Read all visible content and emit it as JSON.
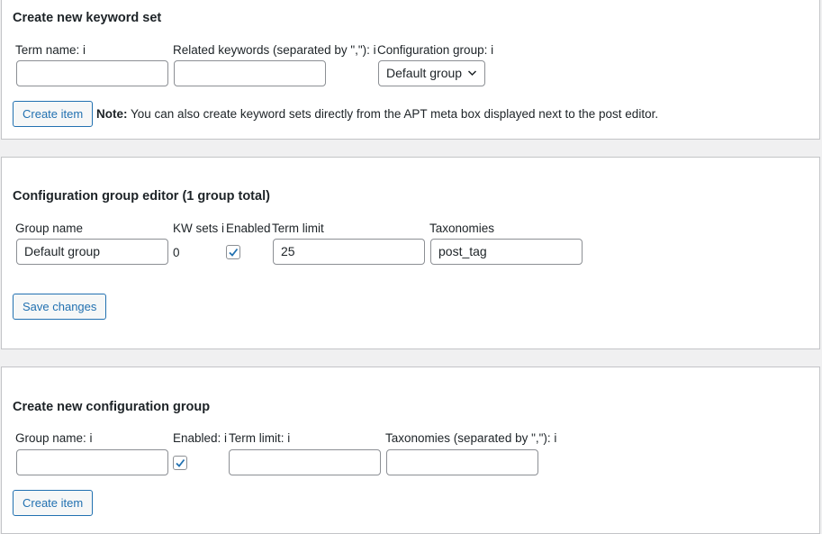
{
  "keyword_set": {
    "title": "Create new keyword set",
    "term_name_label": "Term name: i",
    "related_keywords_label": "Related keywords (separated by \",\"): i",
    "config_group_label": "Configuration group: i",
    "config_group_selected": "Default group",
    "term_name_value": "",
    "related_keywords_value": "",
    "create_button": "Create item",
    "note_label": "Note:",
    "note_text": " You can also create keyword sets directly from the APT meta box displayed next to the post editor."
  },
  "group_editor": {
    "title": "Configuration group editor (1 group total)",
    "columns": {
      "group_name": "Group name",
      "kw_sets": "KW sets i",
      "enabled": "Enabled",
      "term_limit": "Term limit",
      "taxonomies": "Taxonomies"
    },
    "row": {
      "group_name": "Default group",
      "kw_sets": "0",
      "enabled": true,
      "term_limit": "25",
      "taxonomies": "post_tag"
    },
    "save_button": "Save changes"
  },
  "new_group": {
    "title": "Create new configuration group",
    "group_name_label": "Group name: i",
    "enabled_label": "Enabled: i",
    "term_limit_label": "Term limit: i",
    "taxonomies_label": "Taxonomies (separated by \",\"): i",
    "enabled": true,
    "create_button": "Create item"
  },
  "colors": {
    "accent": "#2271b1",
    "border": "#8c8f94",
    "background": "#f0f0f1"
  }
}
